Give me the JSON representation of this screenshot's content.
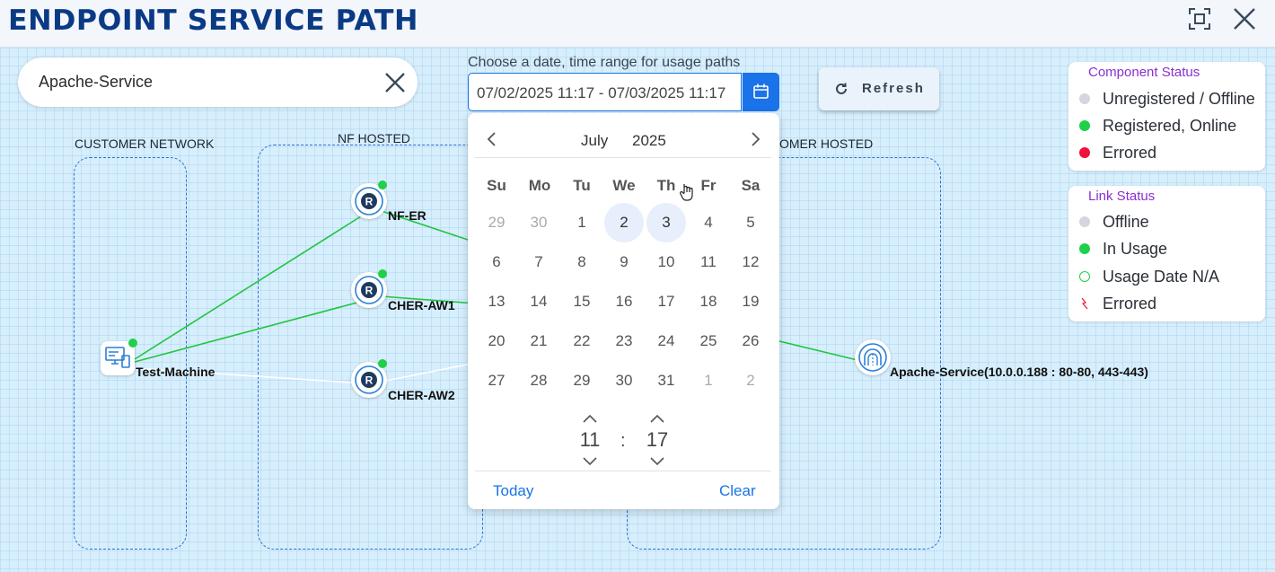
{
  "header": {
    "title": "ENDPOINT SERVICE PATH",
    "fit_icon": "fit-screen-icon",
    "close_icon": "close-icon"
  },
  "search": {
    "value": "Apache-Service",
    "placeholder": ""
  },
  "date_range": {
    "label": "Choose a date, time range for usage paths",
    "value": "07/02/2025 11:17 - 07/03/2025 11:17"
  },
  "refresh": {
    "label": "Refresh"
  },
  "component_status": {
    "title": "Component Status",
    "items": [
      {
        "label": "Unregistered / Offline",
        "color": "#d3d6de"
      },
      {
        "label": "Registered, Online",
        "color": "#1fd04a"
      },
      {
        "label": "Errored",
        "color": "#f0123a"
      }
    ]
  },
  "link_status": {
    "title": "Link Status",
    "items": [
      {
        "label": "Offline",
        "color": "#d3d6de"
      },
      {
        "label": "In Usage",
        "color": "#1fd04a"
      },
      {
        "label": "Usage Date N/A",
        "color": "#1fd04a"
      },
      {
        "label": "Errored",
        "color": "#f0123a"
      }
    ]
  },
  "regions": {
    "customer_network": "CUSTOMER NETWORK",
    "nf_hosted": "NF HOSTED",
    "customer_hosted": "OMER HOSTED"
  },
  "nodes": {
    "test_machine": "Test-Machine",
    "nf_er": "NF-ER",
    "cher_aw1": "CHER-AW1",
    "cher_aw2": "CHER-AW2",
    "apache_service": "Apache-Service(10.0.0.188 : 80-80, 443-443)"
  },
  "calendar": {
    "month": "July",
    "year": "2025",
    "weekdays": [
      "Su",
      "Mo",
      "Tu",
      "We",
      "Th",
      "Fr",
      "Sa"
    ],
    "weeks": [
      [
        "29",
        "30",
        "1",
        "2",
        "3",
        "4",
        "5"
      ],
      [
        "6",
        "7",
        "8",
        "9",
        "10",
        "11",
        "12"
      ],
      [
        "13",
        "14",
        "15",
        "16",
        "17",
        "18",
        "19"
      ],
      [
        "20",
        "21",
        "22",
        "23",
        "24",
        "25",
        "26"
      ],
      [
        "27",
        "28",
        "29",
        "30",
        "31",
        "1",
        "2"
      ]
    ],
    "selected_days": [
      "2",
      "3"
    ],
    "hour": "11",
    "minute": "17",
    "separator": ":",
    "today_label": "Today",
    "clear_label": "Clear"
  }
}
